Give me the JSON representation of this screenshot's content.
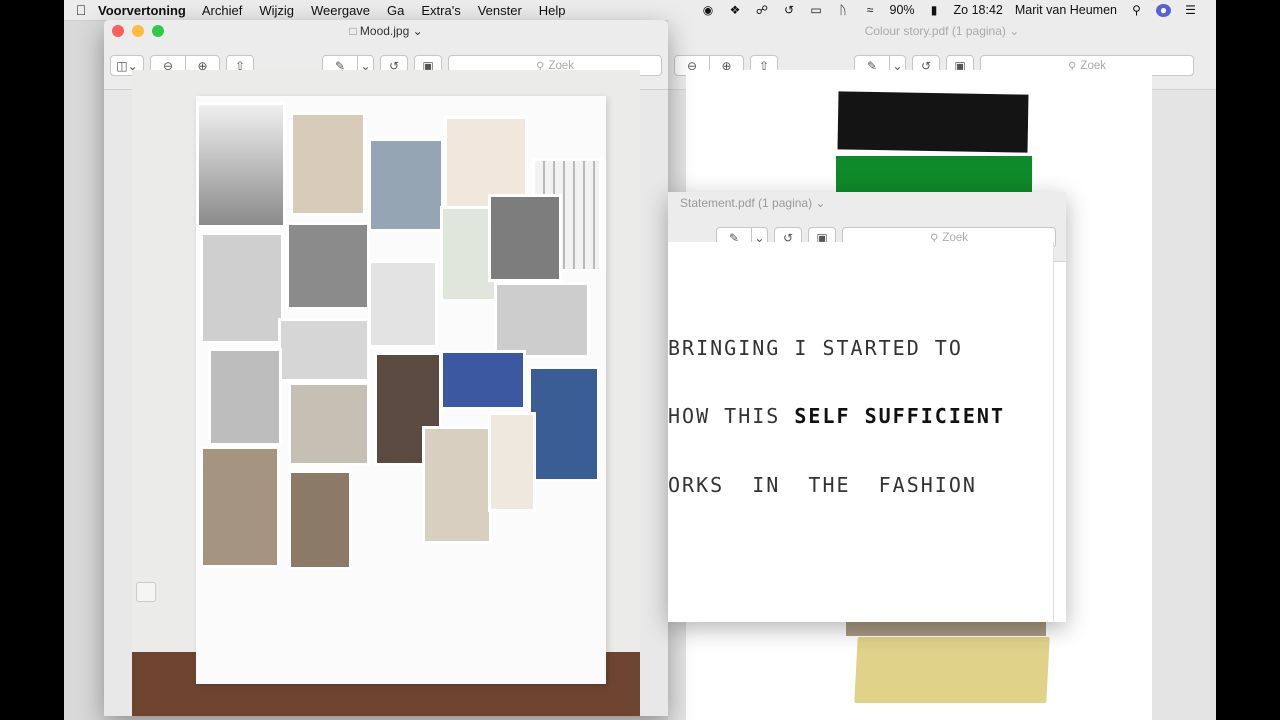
{
  "menubar": {
    "app": "Voorvertoning",
    "items": [
      "Archief",
      "Wijzig",
      "Weergave",
      "Ga",
      "Extra's",
      "Venster",
      "Help"
    ],
    "battery": "90%",
    "clock": "Zo 18:42",
    "user": "Marit van Heumen"
  },
  "mood_window": {
    "title": "Mood.jpg",
    "search_placeholder": "Zoek"
  },
  "colour_window": {
    "title": "Colour story.pdf (1 pagina)",
    "search_placeholder": "Zoek",
    "swatch_colors": [
      "#141414",
      "#0f8a2a",
      "#a99a83",
      "#e0d288"
    ]
  },
  "statement_window": {
    "title": "Statement.pdf (1 pagina)",
    "search_placeholder": "Zoek",
    "line1": "BRINGING I STARTED TO",
    "line2_plain": "HOW THIS ",
    "line2_bold": "SELF SUFFICIENT",
    "line3": "ORKS  IN  THE  FASHION"
  },
  "colors": {
    "close": "#fc605c",
    "minimize": "#fdbc40",
    "zoom": "#34c84a"
  }
}
